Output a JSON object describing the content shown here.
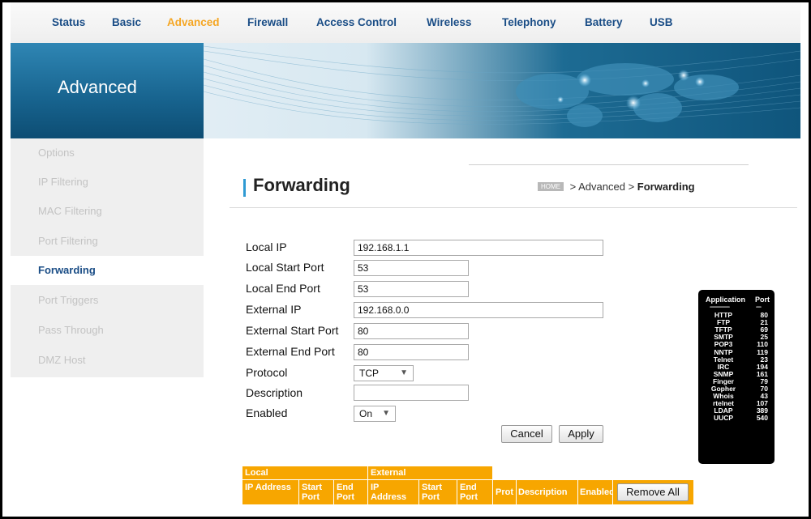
{
  "nav": {
    "items": [
      {
        "label": "Status"
      },
      {
        "label": "Basic"
      },
      {
        "label": "Advanced",
        "active": true
      },
      {
        "label": "Firewall"
      },
      {
        "label": "Access Control"
      },
      {
        "label": "Wireless"
      },
      {
        "label": "Telephony"
      },
      {
        "label": "Battery"
      },
      {
        "label": "USB"
      }
    ]
  },
  "banner": {
    "title": "Advanced"
  },
  "sidebar": {
    "items": [
      {
        "label": "Options"
      },
      {
        "label": "IP Filtering"
      },
      {
        "label": "MAC Filtering"
      },
      {
        "label": "Port Filtering"
      },
      {
        "label": "Forwarding",
        "active": true
      },
      {
        "label": "Port Triggers"
      },
      {
        "label": "Pass Through"
      },
      {
        "label": "DMZ Host"
      }
    ]
  },
  "page": {
    "title": "Forwarding",
    "breadcrumb": {
      "home": "HOME",
      "sep1": ">",
      "section": "Advanced",
      "sep2": ">",
      "current": "Forwarding"
    }
  },
  "form": {
    "local_ip": {
      "label": "Local IP",
      "value": "192.168.1.1"
    },
    "local_start_port": {
      "label": "Local Start Port",
      "value": "53"
    },
    "local_end_port": {
      "label": "Local End Port",
      "value": "53"
    },
    "external_ip": {
      "label": "External IP",
      "value": "192.168.0.0"
    },
    "external_start_port": {
      "label": "External Start Port",
      "value": "80"
    },
    "external_end_port": {
      "label": "External End Port",
      "value": "80"
    },
    "protocol": {
      "label": "Protocol",
      "value": "TCP"
    },
    "description": {
      "label": "Description",
      "value": ""
    },
    "enabled": {
      "label": "Enabled",
      "value": "On"
    },
    "cancel_label": "Cancel",
    "apply_label": "Apply"
  },
  "ports_box": {
    "header_app": "Application",
    "header_port": "Port",
    "rows": [
      {
        "app": "HTTP",
        "port": "80"
      },
      {
        "app": "FTP",
        "port": "21"
      },
      {
        "app": "TFTP",
        "port": "69"
      },
      {
        "app": "SMTP",
        "port": "25"
      },
      {
        "app": "POP3",
        "port": "110"
      },
      {
        "app": "NNTP",
        "port": "119"
      },
      {
        "app": "Telnet",
        "port": "23"
      },
      {
        "app": "IRC",
        "port": "194"
      },
      {
        "app": "SNMP",
        "port": "161"
      },
      {
        "app": "Finger",
        "port": "79"
      },
      {
        "app": "Gopher",
        "port": "70"
      },
      {
        "app": "Whois",
        "port": "43"
      },
      {
        "app": "rtelnet",
        "port": "107"
      },
      {
        "app": "LDAP",
        "port": "389"
      },
      {
        "app": "UUCP",
        "port": "540"
      }
    ]
  },
  "table": {
    "group_local": "Local",
    "group_external": "External",
    "col_local_ip": "IP Address",
    "col_local_start": "Start Port",
    "col_local_end": "End Port",
    "col_ext_ip": "IP Address",
    "col_ext_start": "Start Port",
    "col_ext_end": "End Port",
    "col_prot": "Prot",
    "col_desc": "Description",
    "col_enabled": "Enabled",
    "remove_all_label": "Remove All"
  },
  "colors": {
    "accent_orange": "#f7a600",
    "nav_blue": "#1a4d86",
    "active_tab": "#f5a623",
    "banner_blue": "#17638e"
  }
}
